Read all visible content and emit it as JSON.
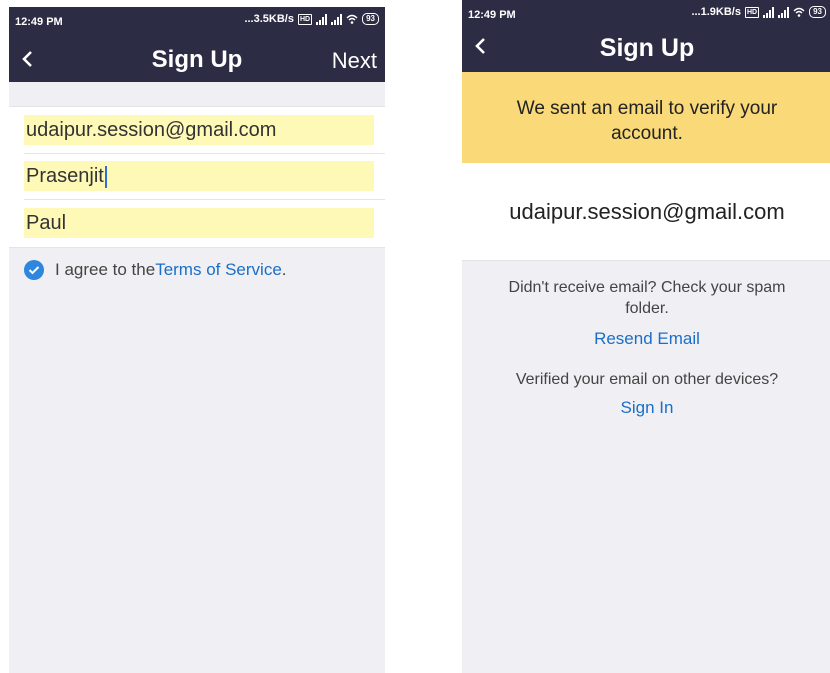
{
  "left": {
    "status": {
      "time": "12:49 PM",
      "speed": "...3.5KB/s",
      "battery": "93"
    },
    "nav": {
      "title": "Sign Up",
      "next": "Next"
    },
    "form": {
      "email": "udaipur.session@gmail.com",
      "first_name": "Prasenjit",
      "last_name": "Paul"
    },
    "agree": {
      "text": "I agree to the ",
      "link": "Terms of Service",
      "period": "."
    }
  },
  "right": {
    "status": {
      "time": "12:49 PM",
      "speed": "...1.9KB/s",
      "battery": "93"
    },
    "nav": {
      "title": "Sign Up"
    },
    "banner": {
      "line1": "We sent an email to verify your",
      "line2": "account."
    },
    "email": "udaipur.session@gmail.com",
    "spam": {
      "line1": "Didn't receive email? Check your spam",
      "line2": "folder."
    },
    "resend": "Resend Email",
    "verified": "Verified your email on other devices?",
    "signin": "Sign In"
  },
  "colors": {
    "nav_bg": "#2c2c44",
    "banner_bg": "#f9d978",
    "field_highlight": "#fff9b8",
    "link": "#1a6ec7",
    "check": "#2e86de"
  }
}
